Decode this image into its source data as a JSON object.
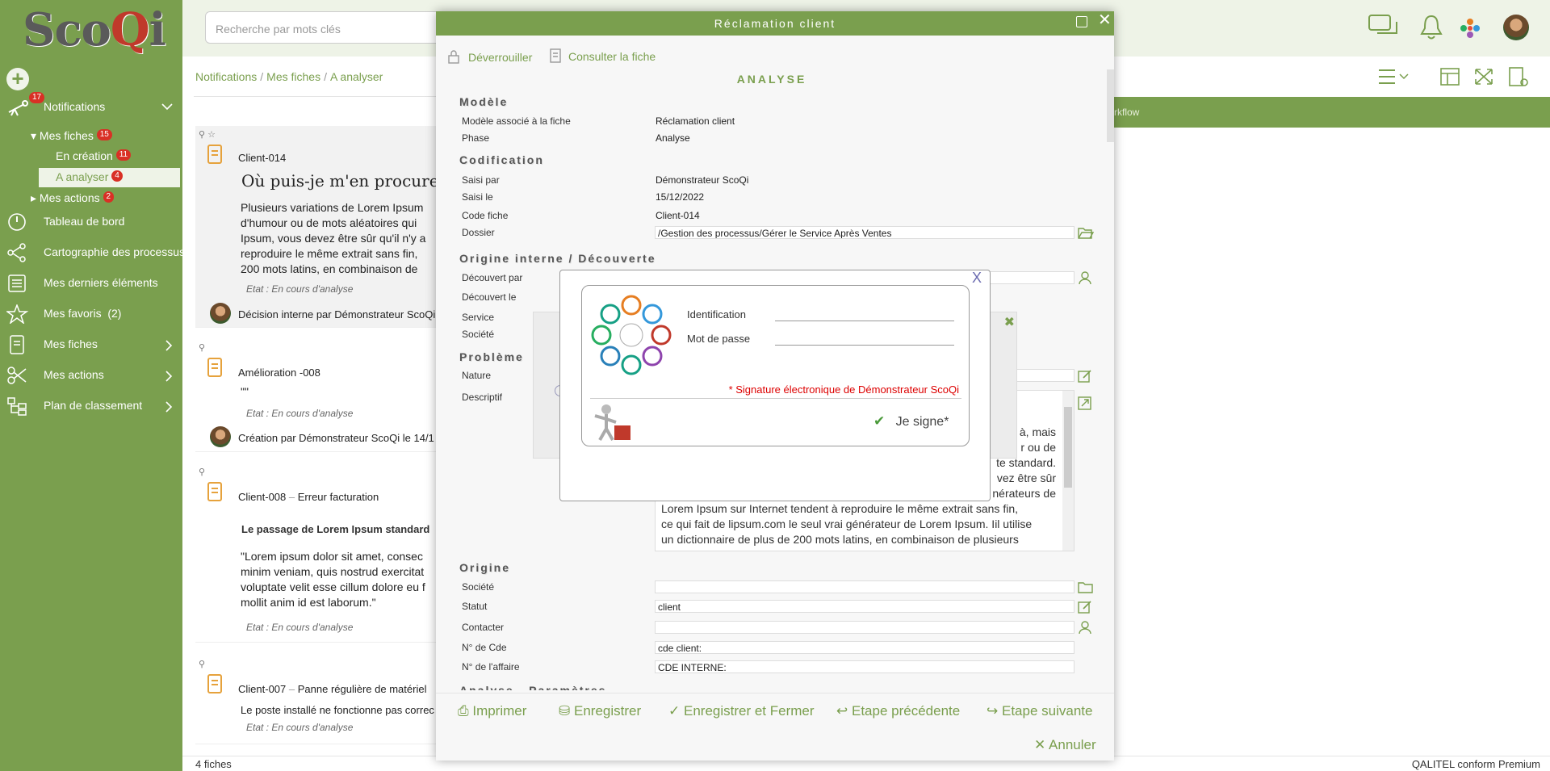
{
  "app": {
    "logo_text": "ScoQi",
    "logo_q": "Q"
  },
  "sidebar": {
    "notifications": {
      "label": "Notifications",
      "badge": "17"
    },
    "mes_fiches_group": {
      "label": "Mes fiches",
      "badge": "15"
    },
    "en_creation": {
      "label": "En création",
      "badge": "11"
    },
    "a_analyser": {
      "label": "A analyser",
      "badge": "4"
    },
    "mes_actions_group": {
      "label": "Mes actions",
      "badge": "2"
    },
    "tableau": "Tableau de bord",
    "cartographie": "Cartographie des processus",
    "derniers": "Mes derniers éléments",
    "favoris": "Mes favoris",
    "favoris_count": "(2)",
    "mes_fiches": "Mes fiches",
    "mes_actions": "Mes actions",
    "plan": "Plan de classement"
  },
  "search": {
    "placeholder": "Recherche par mots clés"
  },
  "breadcrumb": [
    "Notifications",
    "Mes fiches",
    "A analyser"
  ],
  "cards": [
    {
      "id": "Client-014",
      "title": "Où puis-je m'en procurer",
      "lines": [
        "Plusieurs variations de Lorem Ipsum",
        "d'humour ou de mots aléatoires qui",
        "Ipsum, vous devez être sûr qu'il n'y a",
        "reproduire le même extrait sans fin,",
        "200 mots latins, en combinaison de"
      ],
      "etat": "Etat : En cours d'analyse",
      "footer": "Décision interne par Démonstrateur ScoQi"
    },
    {
      "id": "Amélioration -008",
      "body": "\"\"",
      "etat": "Etat : En cours d'analyse",
      "footer": "Création par Démonstrateur ScoQi le 14/1"
    },
    {
      "id": "Client-008",
      "subtitle": "Erreur facturation",
      "title": "Le passage de Lorem Ipsum standard",
      "lines": [
        "\"Lorem ipsum dolor sit amet, consec",
        "minim veniam, quis nostrud exercitat",
        "voluptate velit esse cillum dolore eu f",
        "mollit anim id est laborum.\""
      ],
      "etat": "Etat : En cours d'analyse"
    },
    {
      "id": "Client-007",
      "subtitle": "Panne régulière de matériel",
      "body": "Le poste installé ne fonctionne pas correc",
      "etat": "Etat : En cours d'analyse"
    }
  ],
  "footer": {
    "count": "4 fiches",
    "brand": "QALITEL conform Premium"
  },
  "workflow_tab": "rkflow",
  "modal": {
    "title": "Réclamation client",
    "unlock": "Déverrouiller",
    "consult": "Consulter la fiche",
    "analyse_heading": "ANALYSE",
    "sections": {
      "modele": "Modèle",
      "codification": "Codification",
      "origine_interne": "Origine interne / Découverte",
      "probleme": "Problème",
      "origine": "Origine",
      "analyse_param": "Analyse - Paramètres"
    },
    "modele": {
      "assoc_label": "Modèle associé à la fiche",
      "assoc_value": "Réclamation client",
      "phase_label": "Phase",
      "phase_value": "Analyse"
    },
    "codif": {
      "saisi_par_label": "Saisi par",
      "saisi_par_value": "Démonstrateur ScoQi",
      "saisi_le_label": "Saisi le",
      "saisi_le_value": "15/12/2022",
      "code_label": "Code fiche",
      "code_value": "Client-014",
      "dossier_label": "Dossier",
      "dossier_value": "/Gestion des processus/Gérer le Service Après Ventes"
    },
    "decouverte": {
      "par": "Découvert par",
      "le": "Découvert le",
      "service": "Service",
      "societe": "Société"
    },
    "probleme": {
      "nature": "Nature",
      "descriptif": "Descriptif",
      "text_right": [
        "à, mais",
        "r ou de",
        "te standard.",
        "vez être sûr",
        "nérateurs de"
      ],
      "text_full": [
        "Lorem Ipsum sur Internet tendent à reproduire le même extrait sans fin,",
        "ce qui fait de lipsum.com le seul vrai générateur de Lorem Ipsum. Iil utilise",
        "un dictionnaire de plus de 200 mots latins, en combinaison de plusieurs"
      ]
    },
    "origine": {
      "societe_label": "Société",
      "societe_value": "",
      "statut_label": "Statut",
      "statut_value": "client",
      "contacter_label": "Contacter",
      "contacter_value": "",
      "cde_label": "N° de Cde",
      "cde_value": "cde client:",
      "affaire_label": "N° de l'affaire",
      "affaire_value": "CDE INTERNE:"
    },
    "buttons": {
      "imprimer": "Imprimer",
      "enregistrer": "Enregistrer",
      "enreg_fermer": "Enregistrer et Fermer",
      "precedente": "Etape précédente",
      "suivante": "Etape suivante",
      "annuler": "Annuler"
    }
  },
  "signature": {
    "close": "X",
    "ident_label": "Identification",
    "pwd_label": "Mot de passe",
    "ident_value": "",
    "pwd_value": "",
    "notice": "* Signature électronique de Démonstrateur ScoQi",
    "sign_button": "Je signe*",
    "close2": "✖"
  },
  "colors": {
    "green": "#7a9f4e",
    "red": "#d93025"
  }
}
